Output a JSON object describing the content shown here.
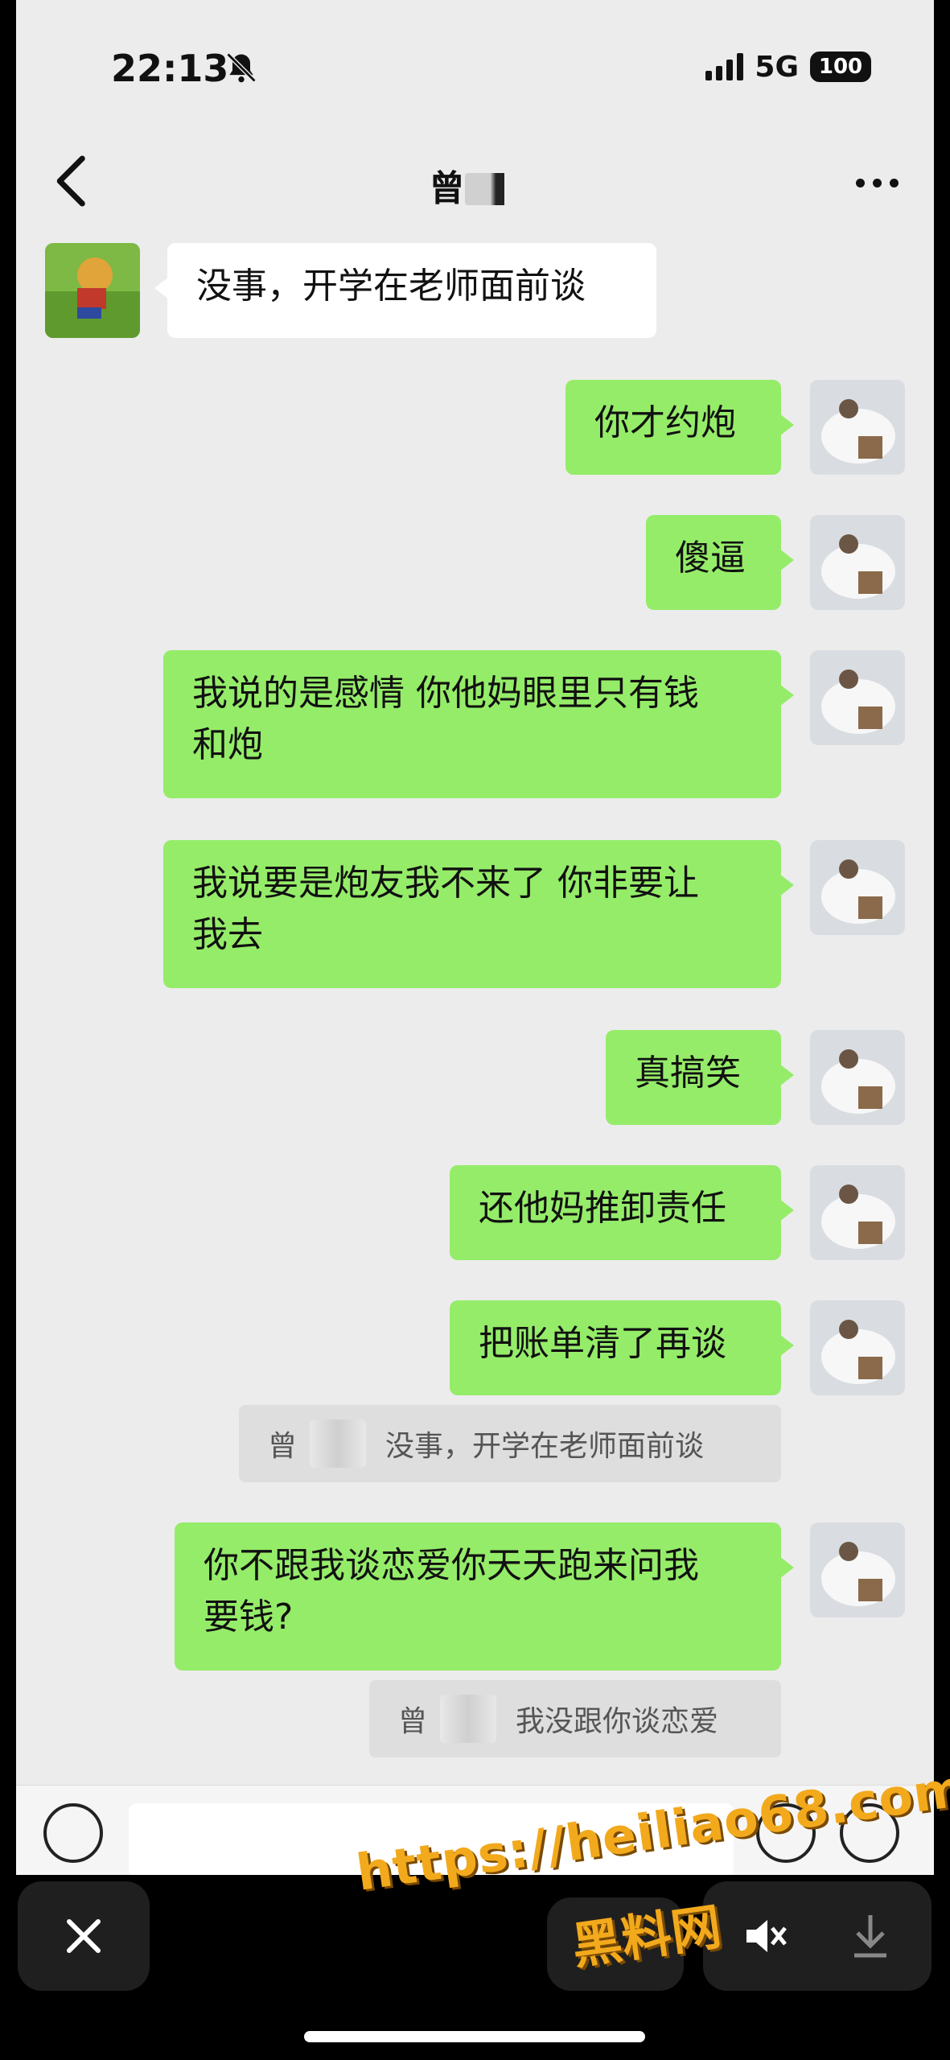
{
  "status_bar": {
    "time": "22:13",
    "network": "5G",
    "battery": "100"
  },
  "header": {
    "title": "曾"
  },
  "messages": [
    {
      "side": "left",
      "text": "没事，开学在老师面前谈"
    },
    {
      "side": "right",
      "text": "你才约炮"
    },
    {
      "side": "right",
      "text": "傻逼"
    },
    {
      "side": "right",
      "text": "我说的是感情 你他妈眼里只有钱\n和炮"
    },
    {
      "side": "right",
      "text": "我说要是炮友我不来了 你非要让\n我去"
    },
    {
      "side": "right",
      "text": "真搞笑"
    },
    {
      "side": "right",
      "text": "还他妈推卸责任"
    },
    {
      "side": "right",
      "text": "把账单清了再谈"
    },
    {
      "side": "right",
      "text": "你不跟我谈恋爱你天天跑来问我\n要钱?"
    }
  ],
  "quotes": [
    {
      "name": "曾",
      "text": "没事，开学在老师面前谈"
    },
    {
      "name": "曾",
      "text": "我没跟你谈恋爱"
    }
  ],
  "watermark": {
    "url": "https://heiliao68.com",
    "name": "黑料网"
  },
  "colors": {
    "bubble_green": "#95ec69",
    "background": "#ececec"
  }
}
